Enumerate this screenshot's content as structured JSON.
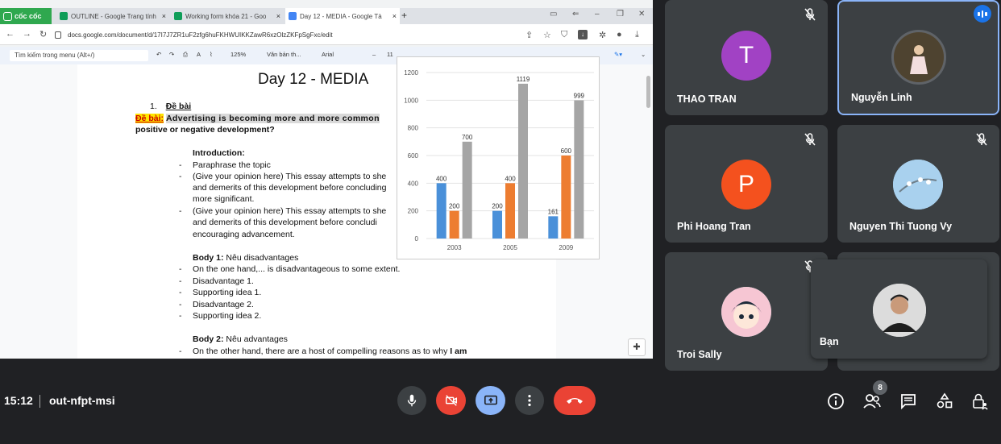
{
  "browser": {
    "brand": "cốc cốc",
    "tabs": [
      {
        "title": "OUTLINE - Google Trang tính",
        "color": "#0f9d58"
      },
      {
        "title": "Working form khóa 21 - Goo",
        "color": "#0f9d58"
      },
      {
        "title": "Day 12 - MEDIA - Google Tà",
        "color": "#4285f4"
      }
    ],
    "url": "docs.google.com/document/d/17I7J7ZR1uF2zfg6huFKHWUIKKZawR6xzOlzZKFpSgFxc/edit"
  },
  "docs_toolbar": {
    "menu_search_placeholder": "Tìm kiếm trong menu (Alt+/)",
    "zoom": "125%",
    "style": "Văn bản th...",
    "font": "Arial",
    "font_size": "11"
  },
  "document": {
    "title": "Day 12 - MEDIA",
    "section_number": "1.",
    "section_heading": "Đề bài",
    "prompt_label": "Đề bài:",
    "prompt_text": "Advertising is becoming more and more common",
    "prompt_line2": "positive or negative development?",
    "intro_heading": "Introduction:",
    "intro_items": [
      "Paraphrase the topic",
      "(Give your opinion here) This essay attempts to she",
      "and demerits of this development before concluding",
      "more significant.",
      "(Give your opinion here) This essay attempts to she",
      "and demerits of this development before concludi",
      "encouraging advancement."
    ],
    "body1_heading": "Body 1:",
    "body1_title": " Nêu disadvantages",
    "body1_items": [
      "On the one hand,... is disadvantageous to some extent.",
      "Disadvantage 1.",
      "Supporting idea 1.",
      "Disadvantage 2.",
      "Supporting idea 2."
    ],
    "body2_heading": "Body 2:",
    "body2_title": " Nêu advantages",
    "body2_line": "On the other hand, there are a host of compelling reasons as to why ",
    "body2_bold": "I am"
  },
  "chart_data": {
    "type": "bar",
    "categories": [
      "2003",
      "2005",
      "2009"
    ],
    "series": [
      {
        "values": [
          400,
          200,
          161
        ],
        "color": "#4a90d9"
      },
      {
        "values": [
          200,
          400,
          600
        ],
        "color": "#ed7d31"
      },
      {
        "values": [
          700,
          1119,
          999
        ],
        "color": "#a5a5a5"
      }
    ],
    "ylim": [
      0,
      1200
    ],
    "yticks": [
      0,
      200,
      400,
      600,
      800,
      1000,
      1200
    ],
    "grid": true
  },
  "participants": [
    {
      "name": "THAO TRAN",
      "initial": "T",
      "color": "#a142c4",
      "muted": true
    },
    {
      "name": "Nguyễn Linh",
      "initial": "",
      "color": "#6b5a3e",
      "muted": false,
      "speaking": true
    },
    {
      "name": "Phi Hoang Tran",
      "initial": "P",
      "color": "#f4511e",
      "muted": true
    },
    {
      "name": "Nguyen Thi Tuong Vy",
      "initial": "",
      "color": "#7fb3d5",
      "muted": true
    },
    {
      "name": "Troi Sally",
      "initial": "",
      "color": "#7ecfd3",
      "muted": true
    }
  ],
  "self": {
    "name": "Bạn"
  },
  "meeting": {
    "time": "15:12",
    "code": "out-nfpt-msi",
    "participant_count": "8"
  },
  "colors": {
    "end_call": "#ea4335",
    "camera_off": "#ea4335",
    "present": "#8ab4f8"
  }
}
